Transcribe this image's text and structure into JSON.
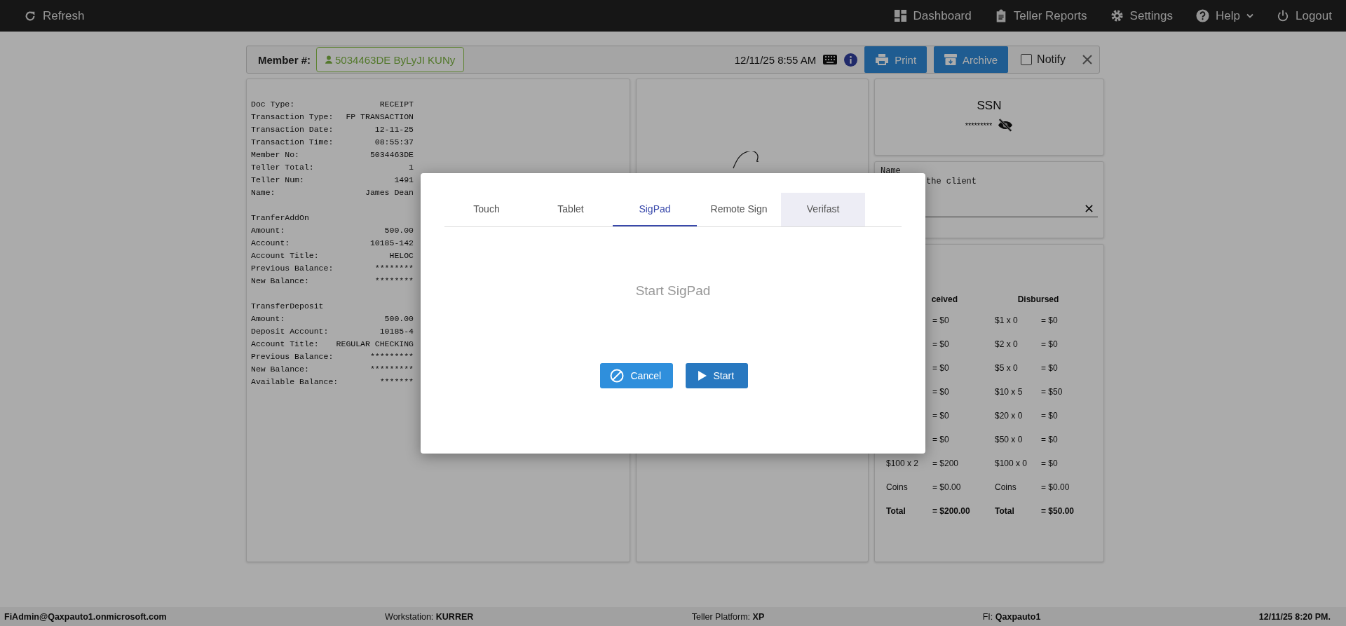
{
  "topbar": {
    "refresh": "Refresh",
    "items": [
      {
        "kind": "dashboard",
        "label": "Dashboard"
      },
      {
        "kind": "reports",
        "label": "Teller Reports"
      },
      {
        "kind": "settings",
        "label": "Settings"
      },
      {
        "kind": "help",
        "label": "Help"
      },
      {
        "kind": "logout",
        "label": "Logout"
      }
    ]
  },
  "header": {
    "member_label": "Member #:",
    "member": "5034463DE ByLyJI KUNy",
    "datetime": "12/11/25 8:55 AM",
    "print": "Print",
    "archive": "Archive",
    "notify": {
      "label": "Notify",
      "checked": false
    }
  },
  "receipt": {
    "sections": [
      {
        "lines": [
          {
            "label": "Doc Type:",
            "value": "RECEIPT"
          },
          {
            "label": "Transaction Type:",
            "value": "FP TRANSACTION"
          },
          {
            "label": "Transaction Date:",
            "value": "12-11-25"
          },
          {
            "label": "Transaction Time:",
            "value": "08:55:37"
          },
          {
            "label": "Member No:",
            "value": "5034463DE"
          },
          {
            "label": "Teller Total:",
            "value": "1"
          },
          {
            "label": "Teller Num:",
            "value": "1491"
          },
          {
            "label": "Name:",
            "value": "James Dean"
          }
        ]
      },
      {
        "heading": "TranferAddOn",
        "lines": [
          {
            "label": "Amount:",
            "value": "500.00"
          },
          {
            "label": "Account:",
            "value": "10185-142"
          },
          {
            "label": "Account Title:",
            "value": "HELOC"
          },
          {
            "label": "Previous Balance:",
            "value": "********"
          },
          {
            "label": "New Balance:",
            "value": "********"
          }
        ]
      },
      {
        "heading": "TransferDeposit",
        "lines": [
          {
            "label": "Amount:",
            "value": "500.00"
          },
          {
            "label": "Deposit Account:",
            "value": "10185-4"
          },
          {
            "label": "Account Title:",
            "value": "REGULAR CHECKING"
          },
          {
            "label": "Previous Balance:",
            "value": "*********"
          },
          {
            "label": "New Balance:",
            "value": "*********"
          },
          {
            "label": "Available Balance:",
            "value": "*******"
          }
        ]
      }
    ]
  },
  "ssn": {
    "title": "SSN",
    "value": "*********"
  },
  "notes": {
    "label": "Name",
    "text": "the client"
  },
  "cash": {
    "received": {
      "title": "ceived",
      "rows": [
        {
          "value": "= $0"
        },
        {
          "value": "= $0"
        },
        {
          "value": "= $0"
        },
        {
          "value": "= $0"
        },
        {
          "value": "= $0"
        },
        {
          "value": "= $0"
        },
        {
          "label": "$100 x 2",
          "value": "= $200"
        },
        {
          "label": "Coins",
          "value": "= $0.00"
        },
        {
          "label": "Total",
          "value": "= $200.00",
          "total": true
        }
      ]
    },
    "disbursed": {
      "title": "Disbursed",
      "rows": [
        {
          "label": "$1 x 0",
          "value": "= $0"
        },
        {
          "label": "$2 x 0",
          "value": "= $0"
        },
        {
          "label": "$5 x 0",
          "value": "= $0"
        },
        {
          "label": "$10 x 5",
          "value": "= $50"
        },
        {
          "label": "$20 x 0",
          "value": "= $0"
        },
        {
          "label": "$50 x 0",
          "value": "= $0"
        },
        {
          "label": "$100 x 0",
          "value": "= $0"
        },
        {
          "label": "Coins",
          "value": "= $0.00"
        },
        {
          "label": "Total",
          "value": "= $50.00",
          "total": true
        }
      ]
    }
  },
  "dialog": {
    "tabs": [
      {
        "label": "Touch",
        "selected": false,
        "hovered": false
      },
      {
        "label": "Tablet",
        "selected": false,
        "hovered": false
      },
      {
        "label": "SigPad",
        "selected": true,
        "hovered": false
      },
      {
        "label": "Remote Sign",
        "selected": false,
        "hovered": false
      },
      {
        "label": "Verifast",
        "selected": false,
        "hovered": true
      }
    ],
    "message": "Start SigPad",
    "cancel": "Cancel",
    "start": "Start"
  },
  "status_bar": [
    "**FiAdmin@Qaxpauto1.onmicrosoft.com**",
    "Workstation: **KURRER**",
    "Teller Platform: **XP**",
    "FI: **Qaxpauto1**",
    "**12/11/25 8:20 PM.**"
  ]
}
